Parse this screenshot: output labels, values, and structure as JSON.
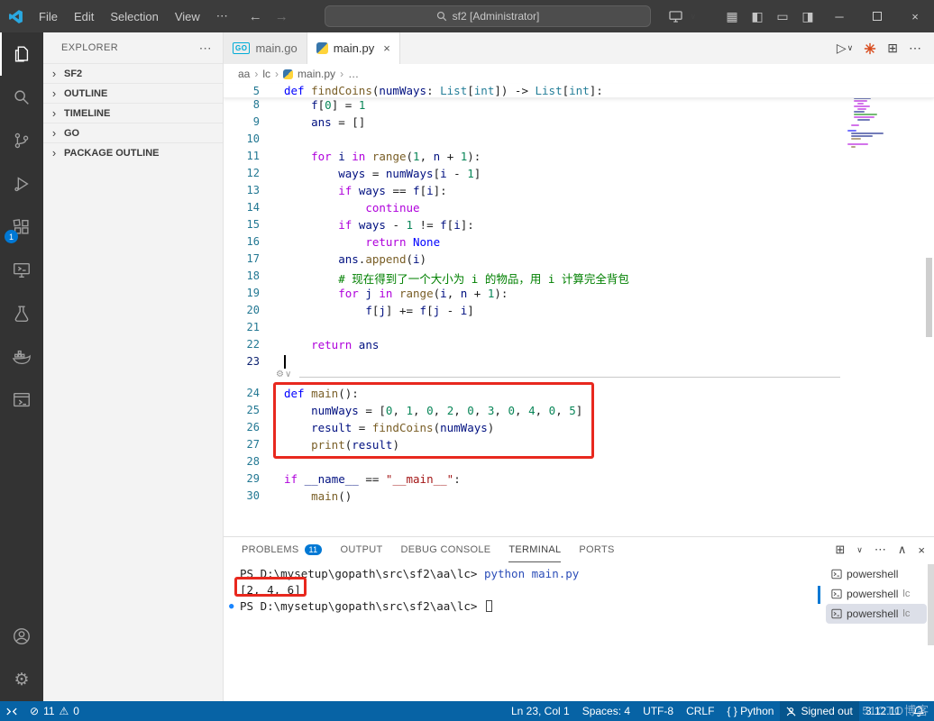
{
  "colors": {
    "titlebar": "#3c3c3c",
    "activitybar": "#333333",
    "sidebar": "#f3f3f3",
    "statusbar": "#0763a5",
    "accent": "#0078d4",
    "annotation": "#e8281e"
  },
  "token_colors": {
    "kw": "#0000ff",
    "ctrl": "#af00db",
    "fn": "#795e26",
    "var": "#001080",
    "type": "#267f99",
    "num": "#098658",
    "str": "#a31515",
    "com": "#008000",
    "pl": "#1f1f1f",
    "cmd": "#2b4db8"
  },
  "icons": {
    "more": "⋯",
    "back": "←",
    "forward": "→",
    "chevron_down": "∨",
    "chevron_right": "›",
    "run": "▷",
    "split": "⊞",
    "layout": "▦",
    "sidebar_left": "◧",
    "panel_rect": "▭",
    "sidebar_right": "◨",
    "minimize": "─",
    "close": "×",
    "error": "⊘",
    "warning": "⚠",
    "gear": "⚙",
    "caret_up": "∧",
    "dot": "●",
    "go": "GO"
  },
  "titlebar": {
    "menus": [
      "File",
      "Edit",
      "Selection",
      "View"
    ],
    "search": "sf2 [Administrator]"
  },
  "activity": {
    "extensions_badge": "1"
  },
  "sidebar": {
    "title": "EXPLORER",
    "sections": [
      "SF2",
      "OUTLINE",
      "TIMELINE",
      "GO",
      "PACKAGE OUTLINE"
    ]
  },
  "tabs": [
    {
      "label": "main.go",
      "icon_text": "GO"
    },
    {
      "label": "main.py"
    }
  ],
  "breadcrumbs": {
    "items": [
      "aa",
      "lc",
      "main.py",
      "…"
    ]
  },
  "editor": {
    "current_line": 23,
    "sticky": {
      "n": 5,
      "t": [
        [
          "kw",
          "def"
        ],
        [
          "pl",
          " "
        ],
        [
          "fn",
          "findCoins"
        ],
        [
          "pl",
          "("
        ],
        [
          "var",
          "numWays"
        ],
        [
          "pl",
          ": "
        ],
        [
          "type",
          "List"
        ],
        [
          "pl",
          "["
        ],
        [
          "type",
          "int"
        ],
        [
          "pl",
          "]) -> "
        ],
        [
          "type",
          "List"
        ],
        [
          "pl",
          "["
        ],
        [
          "type",
          "int"
        ],
        [
          "pl",
          "]:"
        ]
      ]
    },
    "lines": [
      {
        "n": 8,
        "t": [
          [
            "pl",
            "    "
          ],
          [
            "var",
            "f"
          ],
          [
            "pl",
            "["
          ],
          [
            "num",
            "0"
          ],
          [
            "pl",
            "] = "
          ],
          [
            "num",
            "1"
          ]
        ]
      },
      {
        "n": 9,
        "t": [
          [
            "pl",
            "    "
          ],
          [
            "var",
            "ans"
          ],
          [
            "pl",
            " = []"
          ]
        ]
      },
      {
        "n": 10,
        "t": []
      },
      {
        "n": 11,
        "t": [
          [
            "pl",
            "    "
          ],
          [
            "ctrl",
            "for"
          ],
          [
            "pl",
            " "
          ],
          [
            "var",
            "i"
          ],
          [
            "pl",
            " "
          ],
          [
            "ctrl",
            "in"
          ],
          [
            "pl",
            " "
          ],
          [
            "fn",
            "range"
          ],
          [
            "pl",
            "("
          ],
          [
            "num",
            "1"
          ],
          [
            "pl",
            ", "
          ],
          [
            "var",
            "n"
          ],
          [
            "pl",
            " + "
          ],
          [
            "num",
            "1"
          ],
          [
            "pl",
            "):"
          ]
        ]
      },
      {
        "n": 12,
        "t": [
          [
            "pl",
            "        "
          ],
          [
            "var",
            "ways"
          ],
          [
            "pl",
            " = "
          ],
          [
            "var",
            "numWays"
          ],
          [
            "pl",
            "["
          ],
          [
            "var",
            "i"
          ],
          [
            "pl",
            " - "
          ],
          [
            "num",
            "1"
          ],
          [
            "pl",
            "]"
          ]
        ]
      },
      {
        "n": 13,
        "t": [
          [
            "pl",
            "        "
          ],
          [
            "ctrl",
            "if"
          ],
          [
            "pl",
            " "
          ],
          [
            "var",
            "ways"
          ],
          [
            "pl",
            " == "
          ],
          [
            "var",
            "f"
          ],
          [
            "pl",
            "["
          ],
          [
            "var",
            "i"
          ],
          [
            "pl",
            "]:"
          ]
        ]
      },
      {
        "n": 14,
        "t": [
          [
            "pl",
            "            "
          ],
          [
            "ctrl",
            "continue"
          ]
        ]
      },
      {
        "n": 15,
        "t": [
          [
            "pl",
            "        "
          ],
          [
            "ctrl",
            "if"
          ],
          [
            "pl",
            " "
          ],
          [
            "var",
            "ways"
          ],
          [
            "pl",
            " - "
          ],
          [
            "num",
            "1"
          ],
          [
            "pl",
            " != "
          ],
          [
            "var",
            "f"
          ],
          [
            "pl",
            "["
          ],
          [
            "var",
            "i"
          ],
          [
            "pl",
            "]:"
          ]
        ]
      },
      {
        "n": 16,
        "t": [
          [
            "pl",
            "            "
          ],
          [
            "ctrl",
            "return"
          ],
          [
            "pl",
            " "
          ],
          [
            "kw",
            "None"
          ]
        ]
      },
      {
        "n": 17,
        "t": [
          [
            "pl",
            "        "
          ],
          [
            "var",
            "ans"
          ],
          [
            "pl",
            "."
          ],
          [
            "fn",
            "append"
          ],
          [
            "pl",
            "("
          ],
          [
            "var",
            "i"
          ],
          [
            "pl",
            ")"
          ]
        ]
      },
      {
        "n": 18,
        "t": [
          [
            "pl",
            "        "
          ],
          [
            "com",
            "# 现在得到了一个大小为 i 的物品，用 i 计算完全背包"
          ]
        ]
      },
      {
        "n": 19,
        "t": [
          [
            "pl",
            "        "
          ],
          [
            "ctrl",
            "for"
          ],
          [
            "pl",
            " "
          ],
          [
            "var",
            "j"
          ],
          [
            "pl",
            " "
          ],
          [
            "ctrl",
            "in"
          ],
          [
            "pl",
            " "
          ],
          [
            "fn",
            "range"
          ],
          [
            "pl",
            "("
          ],
          [
            "var",
            "i"
          ],
          [
            "pl",
            ", "
          ],
          [
            "var",
            "n"
          ],
          [
            "pl",
            " + "
          ],
          [
            "num",
            "1"
          ],
          [
            "pl",
            "):"
          ]
        ]
      },
      {
        "n": 20,
        "t": [
          [
            "pl",
            "            "
          ],
          [
            "var",
            "f"
          ],
          [
            "pl",
            "["
          ],
          [
            "var",
            "j"
          ],
          [
            "pl",
            "] += "
          ],
          [
            "var",
            "f"
          ],
          [
            "pl",
            "["
          ],
          [
            "var",
            "j"
          ],
          [
            "pl",
            " - "
          ],
          [
            "var",
            "i"
          ],
          [
            "pl",
            "]"
          ]
        ]
      },
      {
        "n": 21,
        "t": []
      },
      {
        "n": 22,
        "t": [
          [
            "pl",
            "    "
          ],
          [
            "ctrl",
            "return"
          ],
          [
            "pl",
            " "
          ],
          [
            "var",
            "ans"
          ]
        ]
      },
      {
        "n": 23,
        "t": []
      },
      {
        "n": 24,
        "gap": true,
        "t": [
          [
            "kw",
            "def"
          ],
          [
            "pl",
            " "
          ],
          [
            "fn",
            "main"
          ],
          [
            "pl",
            "():"
          ]
        ]
      },
      {
        "n": 25,
        "t": [
          [
            "pl",
            "    "
          ],
          [
            "var",
            "numWays"
          ],
          [
            "pl",
            " = ["
          ],
          [
            "num",
            "0"
          ],
          [
            "pl",
            ", "
          ],
          [
            "num",
            "1"
          ],
          [
            "pl",
            ", "
          ],
          [
            "num",
            "0"
          ],
          [
            "pl",
            ", "
          ],
          [
            "num",
            "2"
          ],
          [
            "pl",
            ", "
          ],
          [
            "num",
            "0"
          ],
          [
            "pl",
            ", "
          ],
          [
            "num",
            "3"
          ],
          [
            "pl",
            ", "
          ],
          [
            "num",
            "0"
          ],
          [
            "pl",
            ", "
          ],
          [
            "num",
            "4"
          ],
          [
            "pl",
            ", "
          ],
          [
            "num",
            "0"
          ],
          [
            "pl",
            ", "
          ],
          [
            "num",
            "5"
          ],
          [
            "pl",
            "]"
          ]
        ]
      },
      {
        "n": 26,
        "t": [
          [
            "pl",
            "    "
          ],
          [
            "var",
            "result"
          ],
          [
            "pl",
            " = "
          ],
          [
            "fn",
            "findCoins"
          ],
          [
            "pl",
            "("
          ],
          [
            "var",
            "numWays"
          ],
          [
            "pl",
            ")"
          ]
        ]
      },
      {
        "n": 27,
        "t": [
          [
            "pl",
            "    "
          ],
          [
            "fn",
            "print"
          ],
          [
            "pl",
            "("
          ],
          [
            "var",
            "result"
          ],
          [
            "pl",
            ")"
          ]
        ]
      },
      {
        "n": 28,
        "t": []
      },
      {
        "n": 29,
        "t": [
          [
            "ctrl",
            "if"
          ],
          [
            "pl",
            " "
          ],
          [
            "var",
            "__name__"
          ],
          [
            "pl",
            " == "
          ],
          [
            "str",
            "\"__main__\""
          ],
          [
            "pl",
            ":"
          ]
        ]
      },
      {
        "n": 30,
        "t": [
          [
            "pl",
            "    "
          ],
          [
            "fn",
            "main"
          ],
          [
            "pl",
            "()"
          ]
        ]
      }
    ]
  },
  "panel": {
    "tabs": [
      {
        "label": "PROBLEMS",
        "badge": "11"
      },
      {
        "label": "OUTPUT"
      },
      {
        "label": "DEBUG CONSOLE"
      },
      {
        "label": "TERMINAL"
      },
      {
        "label": "PORTS"
      }
    ]
  },
  "terminal": {
    "lines": [
      {
        "t": [
          [
            "pl",
            "PS D:\\mysetup\\gopath\\src\\sf2\\aa\\lc> "
          ],
          [
            "cmd",
            "python main.py"
          ]
        ]
      },
      {
        "t": [
          [
            "pl",
            "[2, 4, 6]"
          ]
        ]
      },
      {
        "dot": true,
        "cursor": true,
        "t": [
          [
            "pl",
            "PS D:\\mysetup\\gopath\\src\\sf2\\aa\\lc> "
          ]
        ]
      }
    ],
    "list": [
      {
        "label": "powershell",
        "sub": ""
      },
      {
        "label": "powershell",
        "sub": "lc"
      },
      {
        "label": "powershell",
        "sub": "lc"
      }
    ]
  },
  "status": {
    "errors": "11",
    "warnings": "0",
    "line_col": "Ln 23, Col 1",
    "spaces": "Spaces: 4",
    "encoding": "UTF-8",
    "eol": "CRLF",
    "language": "{ } Python",
    "signed_out": "Signed out",
    "python_version": "3.12.11"
  },
  "watermark": {
    "text": "51CTO博客"
  }
}
